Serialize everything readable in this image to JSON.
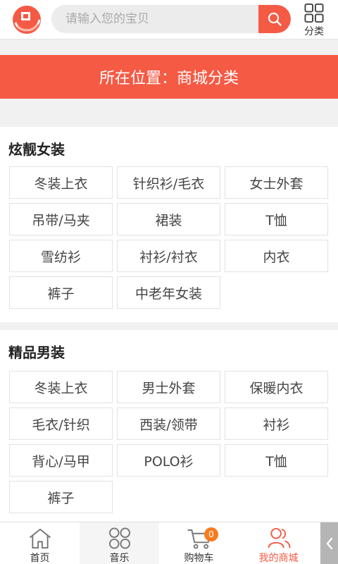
{
  "header": {
    "search_placeholder": "请输入您的宝贝",
    "category_label": "分类"
  },
  "banner": {
    "text": "所在位置：商城分类"
  },
  "sections": [
    {
      "title": "炫靓女装",
      "items": [
        "冬装上衣",
        "针织衫/毛衣",
        "女士外套",
        "吊带/马夹",
        "裙装",
        "T恤",
        "雪纺衫",
        "衬衫/衬衣",
        "内衣",
        "裤子",
        "中老年女装"
      ]
    },
    {
      "title": "精品男装",
      "items": [
        "冬装上衣",
        "男士外套",
        "保暖内衣",
        "毛衣/针织",
        "西装/领带",
        "衬衫",
        "背心/马甲",
        "POLO衫",
        "T恤",
        "裤子"
      ]
    }
  ],
  "bottom_nav": {
    "items": [
      {
        "label": "首页",
        "icon": "home-icon"
      },
      {
        "label": "音乐",
        "icon": "grid-icon"
      },
      {
        "label": "购物车",
        "icon": "cart-icon",
        "badge": "0"
      },
      {
        "label": "我的商城",
        "icon": "user-icon"
      }
    ]
  },
  "colors": {
    "accent": "#f55a45",
    "badge": "#f57c1f"
  }
}
